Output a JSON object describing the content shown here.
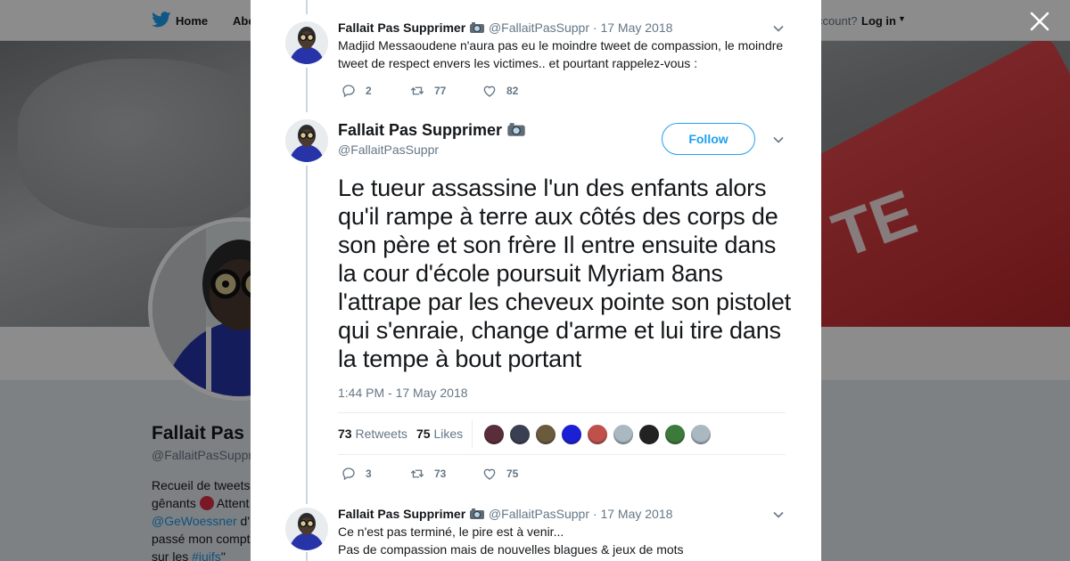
{
  "nav": {
    "home_label": "Home",
    "about_label": "Abo",
    "account_label": "ccount?",
    "login_label": "Log in"
  },
  "banner": {
    "key_text": "TE"
  },
  "profile": {
    "name": "Fallait Pas",
    "handle": "@FallaitPasSuppr",
    "bio_line1": "Recueil de tweets",
    "bio_line2a": "gênants",
    "bio_line2b": "Attent",
    "bio_line3a": "@GeWoessner",
    "bio_line3b": "d'",
    "bio_line4": "passé mon compt",
    "bio_line5a": "sur les",
    "bio_line5b": "#juifs",
    "bio_line5c": "\""
  },
  "tweets": {
    "prev": {
      "name": "Fallait Pas Supprimer",
      "handle": "@FallaitPasSuppr",
      "sep": "·",
      "date": "17 May 2018",
      "text": "Madjid Messaoudene n'aura pas eu le moindre tweet de compassion, le moindre tweet de respect envers les victimes.. et pourtant rappelez-vous :",
      "replies": "2",
      "retweets": "77",
      "likes": "82"
    },
    "main": {
      "name": "Fallait Pas Supprimer",
      "handle": "@FallaitPasSuppr",
      "follow_label": "Follow",
      "text": "Le tueur assassine l'un des enfants alors qu'il rampe à terre aux côtés des corps de son père et son frère Il entre ensuite dans la cour d'école poursuit Myriam 8ans l'attrape par les cheveux pointe son pistolet qui s'enraie, change d'arme et lui tire dans la tempe à bout portant",
      "time": "1:44 PM - 17 May 2018",
      "retweets_count": "73",
      "retweets_label": "Retweets",
      "likes_count": "75",
      "likes_label": "Likes",
      "replies": "3",
      "retweets": "73",
      "likes": "75"
    },
    "next": {
      "name": "Fallait Pas Supprimer",
      "handle": "@FallaitPasSuppr",
      "sep": "·",
      "date": "17 May 2018",
      "line1": "Ce n'est pas terminé, le pire est à venir...",
      "line2": "Pas de compassion mais de nouvelles blagues & jeux de mots"
    }
  },
  "liker_colors": [
    "#5a2d3a",
    "#3b3f52",
    "#6b5a3c",
    "#1b1fd6",
    "#c0504a",
    "#aab8c2",
    "#222222",
    "#3b7a3b",
    "#aab8c2"
  ],
  "colors": {
    "accent": "#1da1f2",
    "text": "#14171a",
    "muted": "#657786"
  }
}
